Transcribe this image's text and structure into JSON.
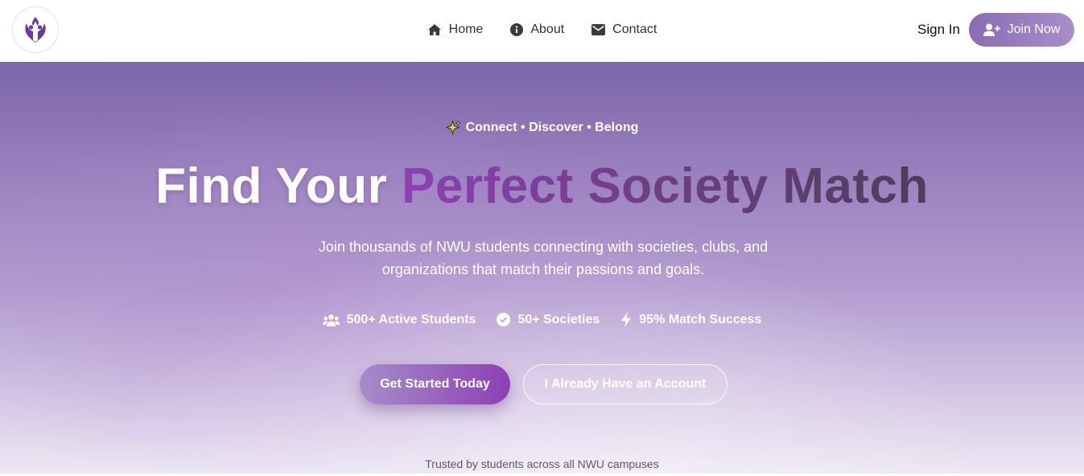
{
  "header": {
    "logo_icon": "university-crest-icon",
    "nav": [
      {
        "label": "Home",
        "icon": "home-icon"
      },
      {
        "label": "About",
        "icon": "info-icon"
      },
      {
        "label": "Contact",
        "icon": "envelope-icon"
      }
    ],
    "sign_in_label": "Sign In",
    "join_now_label": "Join Now"
  },
  "hero": {
    "tagline": "Connect • Discover • Belong",
    "headline": {
      "plain": "Find Your",
      "highlight": "Perfect Society Match"
    },
    "subtext": "Join thousands of NWU students connecting with societies, clubs, and organizations that match their passions and goals.",
    "stats": [
      {
        "label": "500+ Active Students",
        "icon": "users-icon"
      },
      {
        "label": "50+ Societies",
        "icon": "check-circle-icon"
      },
      {
        "label": "95% Match Success",
        "icon": "bolt-icon"
      }
    ],
    "primary_cta": "Get Started Today",
    "secondary_cta": "I Already Have an Account",
    "trusted": "Trusted by students across all NWU campuses"
  },
  "colors": {
    "brand_purple": "#6a3aa0",
    "accent_gradient_start": "#8e3fb5",
    "accent_gradient_end": "#4f3d58",
    "hero_top": "#7d66a8",
    "hero_bottom": "#ede8f3"
  }
}
